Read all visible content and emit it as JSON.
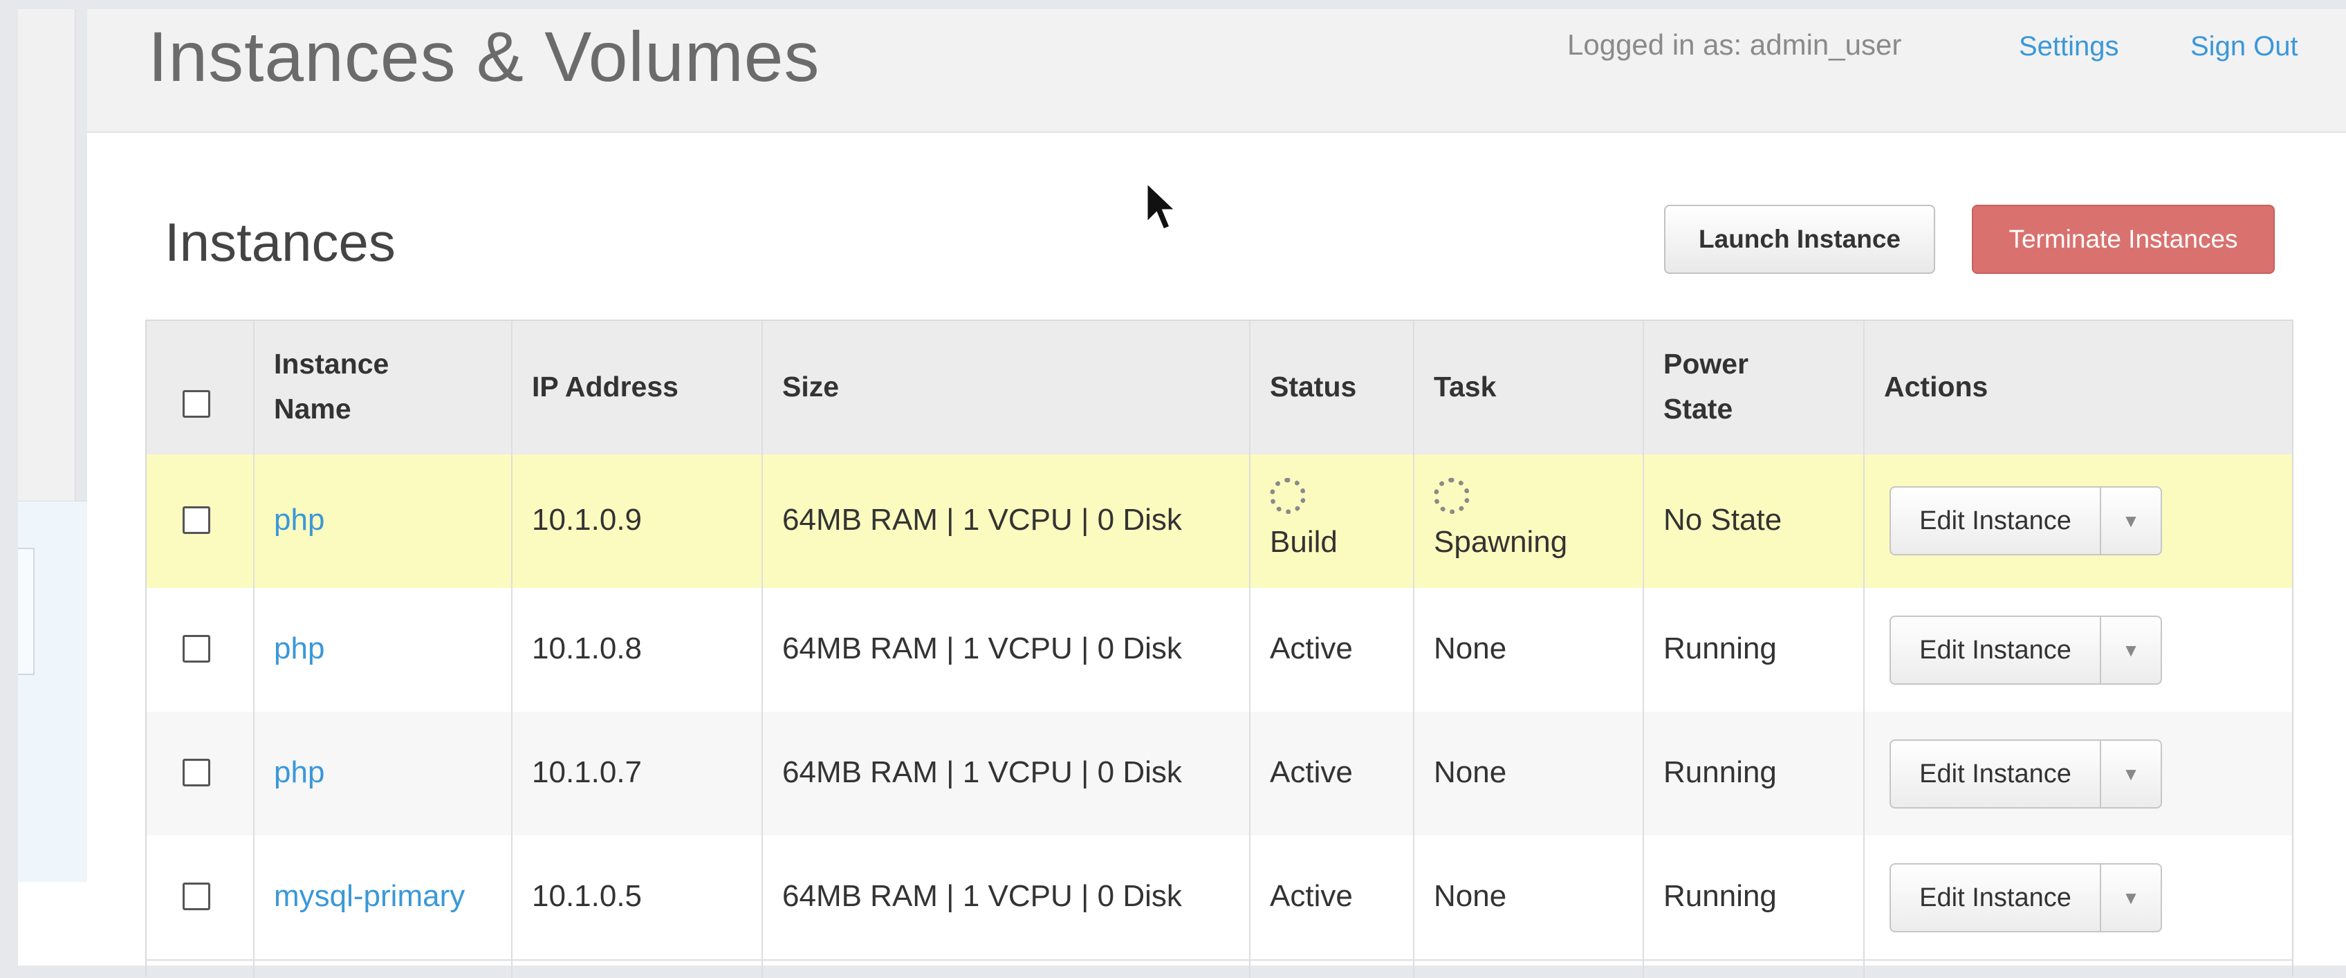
{
  "header": {
    "title": "Instances & Volumes",
    "user_text": "Logged in as: admin_user",
    "settings_link": "Settings",
    "signout_link": "Sign Out"
  },
  "section": {
    "title": "Instances",
    "launch_button": "Launch Instance",
    "terminate_button": "Terminate Instances"
  },
  "table": {
    "headers": {
      "name_line1": "Instance",
      "name_line2": "Name",
      "ip": "IP Address",
      "size": "Size",
      "status": "Status",
      "task": "Task",
      "power_line1": "Power",
      "power_line2": "State",
      "actions": "Actions"
    },
    "rows": [
      {
        "name": "php",
        "ip": "10.1.0.9",
        "size": "64MB RAM | 1 VCPU | 0 Disk",
        "status": "Build",
        "task": "Spawning",
        "power": "No State",
        "action": "Edit Instance",
        "highlighted": true
      },
      {
        "name": "php",
        "ip": "10.1.0.8",
        "size": "64MB RAM | 1 VCPU | 0 Disk",
        "status": "Active",
        "task": "None",
        "power": "Running",
        "action": "Edit Instance"
      },
      {
        "name": "php",
        "ip": "10.1.0.7",
        "size": "64MB RAM | 1 VCPU | 0 Disk",
        "status": "Active",
        "task": "None",
        "power": "Running",
        "action": "Edit Instance"
      },
      {
        "name": "mysql-primary",
        "ip": "10.1.0.5",
        "size": "64MB RAM | 1 VCPU | 0 Disk",
        "status": "Active",
        "task": "None",
        "power": "Running",
        "action": "Edit Instance"
      }
    ]
  },
  "icons": {
    "caret": "▼"
  }
}
